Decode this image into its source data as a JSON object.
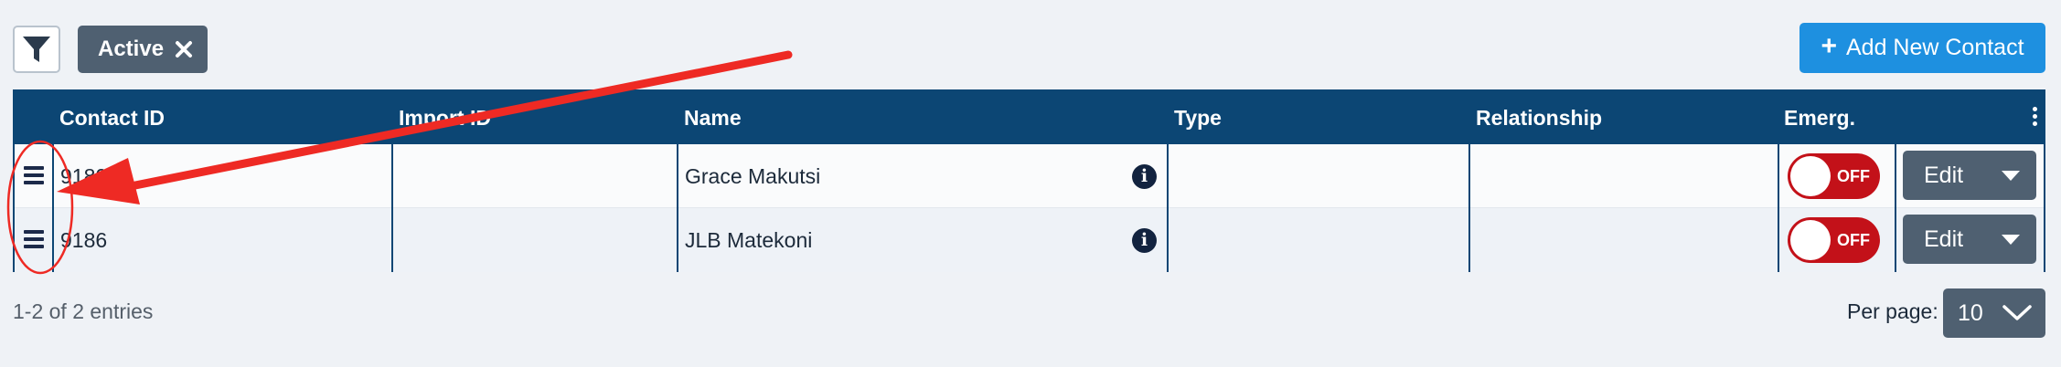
{
  "toolbar": {
    "filter_icon": "funnel-icon",
    "active_chip_label": "Active",
    "active_chip_remove_icon": "close-x-icon",
    "add_button_icon": "plus-icon",
    "add_button_label": "Add New Contact"
  },
  "table": {
    "columns": [
      "Contact ID",
      "Import ID",
      "Name",
      "Type",
      "Relationship",
      "Emerg."
    ],
    "menu_icon": "kebab-icon",
    "rows": [
      {
        "contact_id": "9180",
        "import_id": "",
        "name": "Grace Makutsi",
        "type": "",
        "relationship": "",
        "emerg": "OFF",
        "action": "Edit"
      },
      {
        "contact_id": "9186",
        "import_id": "",
        "name": "JLB Matekoni",
        "type": "",
        "relationship": "",
        "emerg": "OFF",
        "action": "Edit"
      }
    ]
  },
  "footer": {
    "entries_text": "1-2 of 2 entries",
    "per_page_label": "Per page:",
    "per_page_value": "10"
  },
  "colors": {
    "header_bg": "#0c4674",
    "primary_button": "#1e90e0",
    "toggle_off": "#c31119",
    "annotation_red": "#ee2a24",
    "neutral_button": "#4f6071"
  }
}
